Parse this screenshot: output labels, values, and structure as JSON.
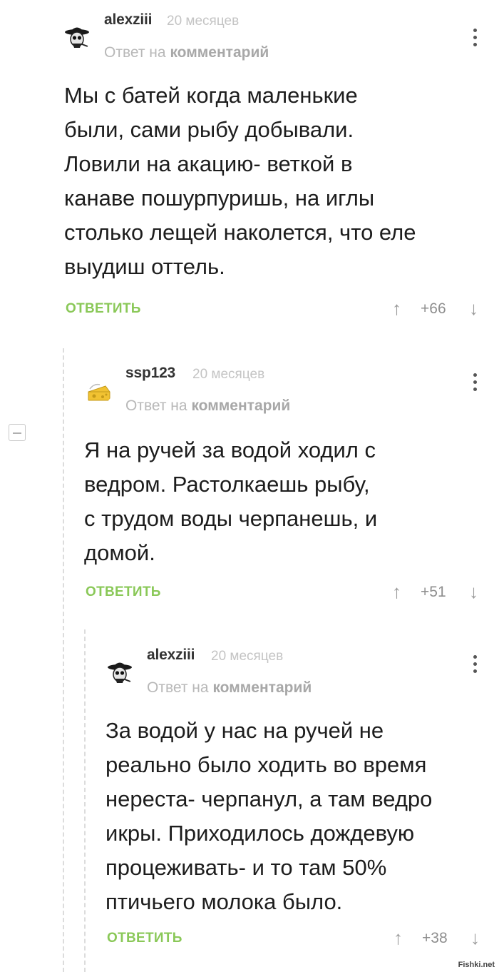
{
  "comments": [
    {
      "username": "alexziii",
      "time": "20 месяцев",
      "reply_prefix": "Ответ на",
      "reply_link": "комментарий",
      "text": "Мы с батей когда маленькие\nбыли, сами рыбу добывали.\nЛовили на акацию- веткой в\nканаве пошурпуришь, на иглы\nстолько лещей наколется, что еле\nвыудиш оттель.",
      "reply_label": "ОТВЕТИТЬ",
      "score": "+66"
    },
    {
      "username": "ssp123",
      "time": "20 месяцев",
      "reply_prefix": "Ответ на",
      "reply_link": "комментарий",
      "text": "Я на ручей за водой ходил с\nведром. Растолкаешь рыбу,\nс трудом воды черпанешь, и\nдомой.",
      "reply_label": "ОТВЕТИТЬ",
      "score": "+51"
    },
    {
      "username": "alexziii",
      "time": "20 месяцев",
      "reply_prefix": "Ответ на",
      "reply_link": "комментарий",
      "text": "За водой у нас на ручей не\nреально было ходить во время\nнереста- черпанул, а там ведро\nикры. Приходилось дождевую\nпроцеживать- и то там 50%\nптичьего молока было.",
      "reply_label": "ОТВЕТИТЬ",
      "score": "+38"
    }
  ],
  "icons": {
    "avatar_1": "cowboy-skull-avatar",
    "avatar_2": "cheese-avatar",
    "avatar_3": "cowboy-skull-avatar",
    "menu": "vertical-dots-icon",
    "upvote": "arrow-up-icon",
    "downvote": "arrow-down-icon",
    "collapse": "minus-collapse-icon"
  },
  "colors": {
    "reply_button": "#8ac858",
    "username": "#333333",
    "meta": "#b8b8b8"
  },
  "watermark": "Fishki.net"
}
